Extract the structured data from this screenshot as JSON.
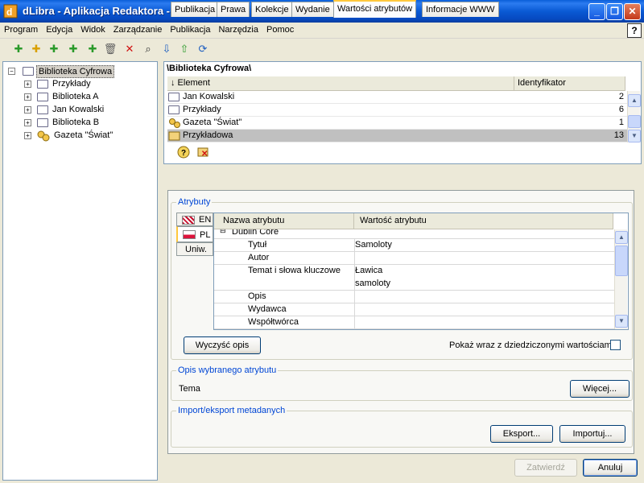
{
  "window": {
    "title": "dLibra - Aplikacja Redaktora - admin"
  },
  "menu": [
    "Program",
    "Edycja",
    "Widok",
    "Zarządzanie",
    "Publikacja",
    "Narzędzia",
    "Pomoc"
  ],
  "toolbar_icons": [
    "add-publication-icon",
    "add-group-icon",
    "add-collection-icon",
    "add-edition-icon",
    "add-element-icon",
    "delete-icon",
    "remove-icon",
    "search-icon",
    "import-icon",
    "export-icon",
    "refresh-icon"
  ],
  "tree": {
    "root": "Biblioteka Cyfrowa",
    "items": [
      "Przykłady",
      "Biblioteka A",
      "Jan Kowalski",
      "Biblioteka B",
      "Gazeta \"Świat\""
    ]
  },
  "element_list": {
    "path": "\\Biblioteka Cyfrowa\\",
    "col_element": "↓ Element",
    "col_id": "Identyfikator",
    "rows": [
      {
        "name": "Jan Kowalski",
        "id": "2"
      },
      {
        "name": "Przykłady",
        "id": "6"
      },
      {
        "name": "Gazeta \"Świat\"",
        "id": "1"
      },
      {
        "name": "Przykładowa",
        "id": "13"
      }
    ]
  },
  "tabs": [
    "Publikacja",
    "Prawa",
    "Kolekcje",
    "Wydanie",
    "Wartości atrybutów",
    "Informacje WWW"
  ],
  "attributes": {
    "group_title": "Atrybuty",
    "languages": [
      "EN",
      "PL",
      "Uniw."
    ],
    "col_name": "Nazwa atrybutu",
    "col_value": "Wartość atrybutu",
    "section": "Dublin Core",
    "rows": [
      {
        "name": "Tytuł",
        "value": "Samoloty"
      },
      {
        "name": "Autor",
        "value": ""
      },
      {
        "name": "Temat i słowa kluczowe",
        "value": "Ławica"
      },
      {
        "name": "",
        "value": "samoloty"
      },
      {
        "name": "Opis",
        "value": ""
      },
      {
        "name": "Wydawca",
        "value": ""
      },
      {
        "name": "Współtwórca",
        "value": ""
      }
    ],
    "clear_button": "Wyczyść opis",
    "inherited_label": "Pokaż wraz z dziedziczonymi wartościami"
  },
  "description": {
    "group_title": "Opis wybranego atrybutu",
    "text": "Tema",
    "more_button": "Więcej..."
  },
  "import_export": {
    "group_title": "Import/eksport metadanych",
    "export_button": "Eksport...",
    "import_button": "Importuj..."
  },
  "footer": {
    "confirm_button": "Zatwierdź",
    "cancel_button": "Anuluj"
  },
  "colors": {
    "titlebar": "#0a5fd8",
    "selection": "#c0c0c0",
    "group_title": "#0046d5"
  }
}
